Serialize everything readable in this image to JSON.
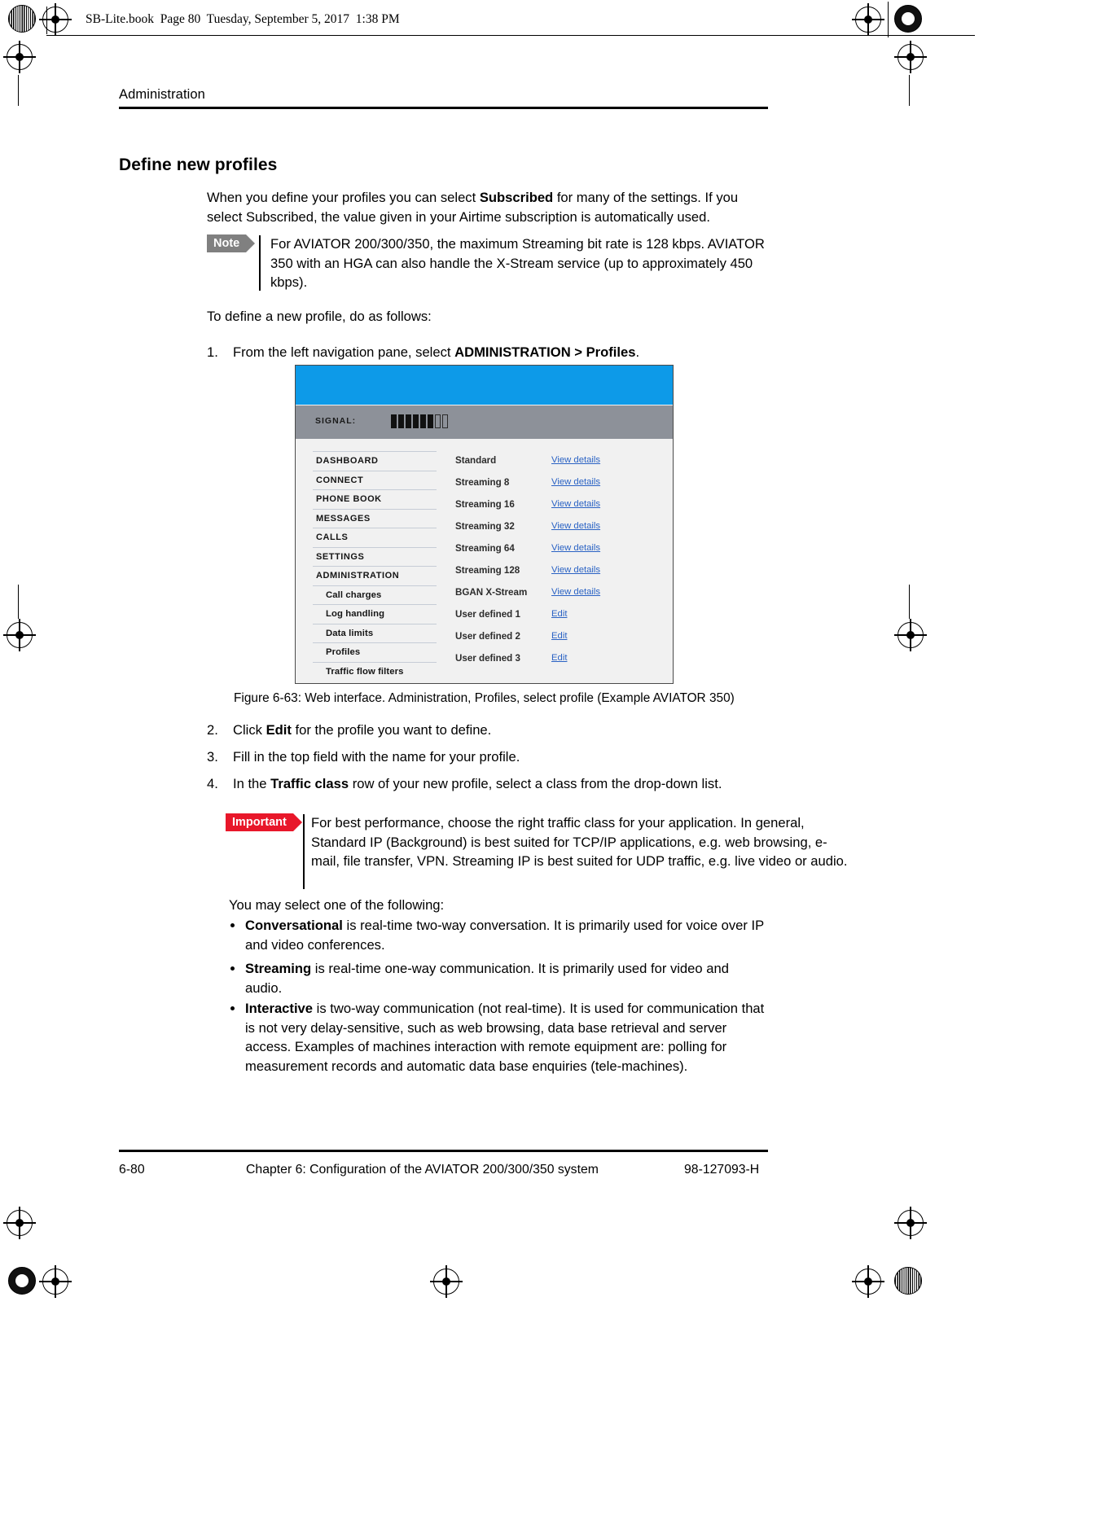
{
  "header": {
    "book_line": "SB-Lite.book  Page 80  Tuesday, September 5, 2017  1:38 PM"
  },
  "running_head": "Administration",
  "section_title": "Define new profiles",
  "intro_paragraph": {
    "part1": "When you define your profiles you can select ",
    "bold1": "Subscribed",
    "part2": " for many of the settings. If you select Subscribed, the value given in your Airtime subscription is automatically used."
  },
  "note": {
    "tag": "Note",
    "text": "For AVIATOR 200/300/350, the maximum Streaming bit rate is 128 kbps. AVIATOR 350 with an HGA can also handle the X-Stream service (up to approximately 450 kbps)."
  },
  "lead_in": "To define a new profile, do as follows:",
  "steps": [
    {
      "num": "1.",
      "part1": "From the left navigation pane, select ",
      "bold1": "ADMINISTRATION > Profiles",
      "part2": "."
    },
    {
      "num": "2.",
      "part1": "Click ",
      "bold1": "Edit",
      "part2": " for the profile you want to define."
    },
    {
      "num": "3.",
      "part1": "Fill in the top field with the name for your profile.",
      "bold1": "",
      "part2": ""
    },
    {
      "num": "4.",
      "part1": "In the ",
      "bold1": "Traffic class",
      "part2": " row of your new profile, select a class from the drop-down list."
    }
  ],
  "figure": {
    "caption": "Figure 6-63: Web interface. Administration, Profiles, select profile (Example AVIATOR 350)",
    "signal_label": "SIGNAL:",
    "signal_bars_filled": 6,
    "signal_bars_empty": 2,
    "topbar_color": "#0d9ae8",
    "signalbar_color": "#8d9199",
    "link_color": "#2a62c4",
    "menu": [
      {
        "label": "DASHBOARD",
        "sub": false
      },
      {
        "label": "CONNECT",
        "sub": false
      },
      {
        "label": "PHONE BOOK",
        "sub": false
      },
      {
        "label": "MESSAGES",
        "sub": false
      },
      {
        "label": "CALLS",
        "sub": false
      },
      {
        "label": "SETTINGS",
        "sub": false
      },
      {
        "label": "ADMINISTRATION",
        "sub": false
      },
      {
        "label": "Call charges",
        "sub": true
      },
      {
        "label": "Log handling",
        "sub": true
      },
      {
        "label": "Data limits",
        "sub": true
      },
      {
        "label": "Profiles",
        "sub": true
      },
      {
        "label": "Traffic flow filters",
        "sub": true
      }
    ],
    "profiles": [
      {
        "name": "Standard",
        "action": "View details"
      },
      {
        "name": "Streaming 8",
        "action": "View details"
      },
      {
        "name": "Streaming 16",
        "action": "View details"
      },
      {
        "name": "Streaming 32",
        "action": "View details"
      },
      {
        "name": "Streaming 64",
        "action": "View details"
      },
      {
        "name": "Streaming 128",
        "action": "View details"
      },
      {
        "name": "BGAN X-Stream",
        "action": "View details"
      },
      {
        "name": "User defined 1",
        "action": "Edit"
      },
      {
        "name": "User defined 2",
        "action": "Edit"
      },
      {
        "name": "User defined 3",
        "action": "Edit"
      }
    ]
  },
  "important": {
    "tag": "Important",
    "text": "For best performance, choose the right traffic class for your application. In general, Standard IP (Background) is best suited for TCP/IP applications, e.g. web browsing, e-mail, file transfer, VPN. Streaming IP is best suited for UDP traffic, e.g. live video or audio."
  },
  "select_one": "You may select one of the following:",
  "bullets": [
    {
      "bold": "Conversational",
      "text": " is real-time two-way conversation. It is primarily used for voice over IP and video conferences."
    },
    {
      "bold": "Streaming",
      "text": " is real-time one-way communication. It is primarily used for video and audio."
    },
    {
      "bold": "Interactive",
      "text": " is two-way communication (not real-time). It is used for communication that is not very delay-sensitive, such as web browsing, data base retrieval and server access. Examples of machines interaction with remote equipment are: polling for measurement records and automatic data base enquiries (tele-machines)."
    }
  ],
  "footer": {
    "left": "6-80",
    "center": "Chapter 6:  Configuration of the AVIATOR 200/300/350 system",
    "right": "98-127093-H"
  }
}
